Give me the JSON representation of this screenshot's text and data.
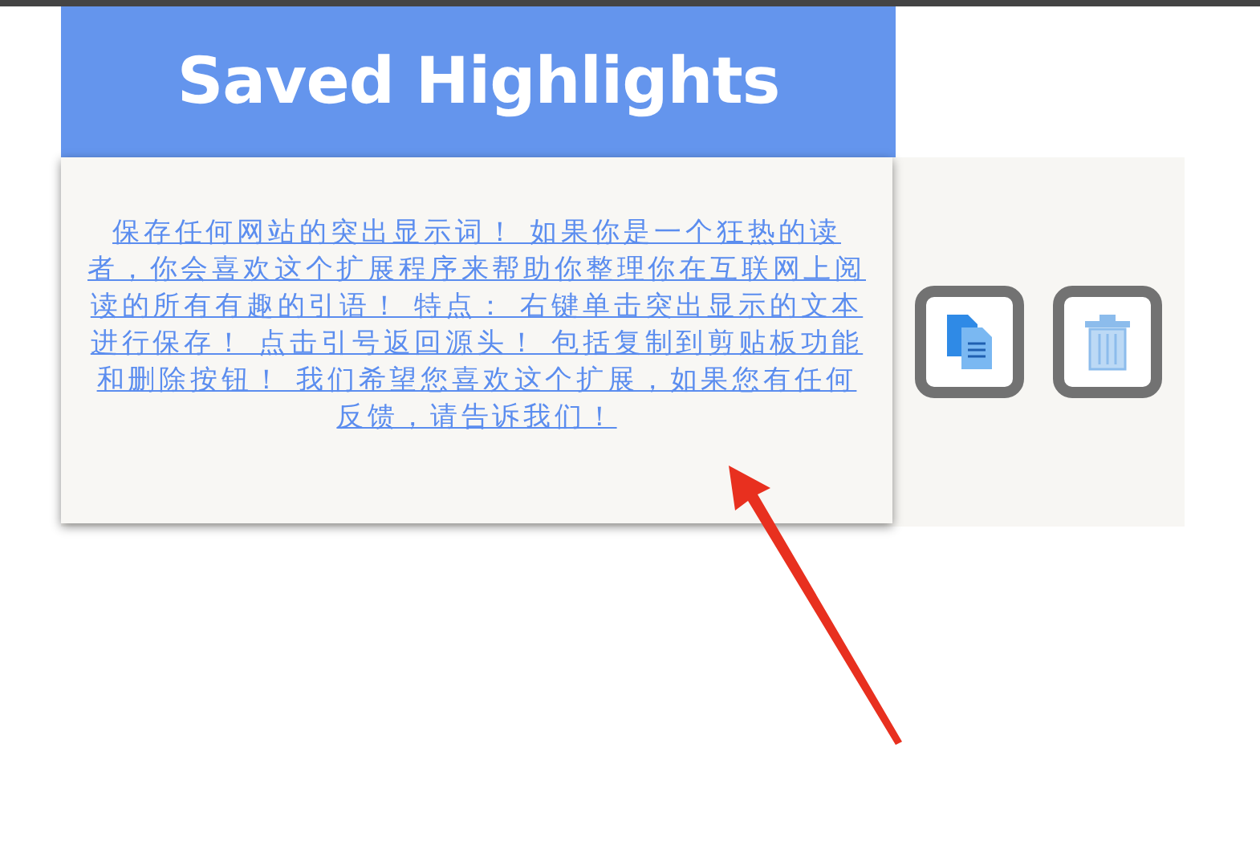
{
  "header": {
    "title": "Saved Highlights"
  },
  "highlights": [
    {
      "text": "保存任何网站的突出显示词！ 如果你是一个狂热的读者，你会喜欢这个扩展程序来帮助你整理你在互联网上阅读的所有有趣的引语！ 特点： 右键单击突出显示的文本进行保存！ 点击引号返回源头！ 包括复制到剪贴板功能和删除按钮！ 我们希望您喜欢这个扩展，如果您有任何反馈，请告诉我们！"
    }
  ],
  "annotation": {
    "kind": "arrow",
    "color": "#e8301f"
  }
}
